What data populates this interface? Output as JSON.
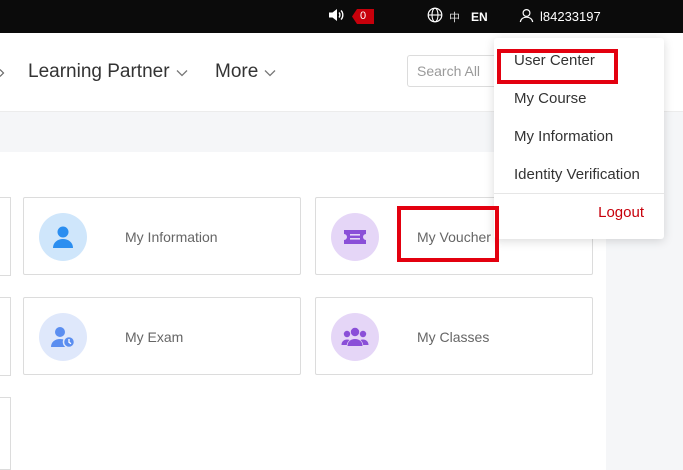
{
  "topbar": {
    "notification_count": "0",
    "lang_cn": "中",
    "lang_en": "EN",
    "username": "l84233197"
  },
  "nav": {
    "learning_partner": "Learning Partner",
    "more": "More"
  },
  "search": {
    "placeholder": "Search All"
  },
  "cards": {
    "my_information": "My Information",
    "my_voucher": "My Voucher",
    "my_exam": "My Exam",
    "my_classes": "My Classes"
  },
  "dropdown": {
    "user_center": "User Center",
    "my_course": "My Course",
    "my_information": "My Information",
    "identity_verification": "Identity Verification",
    "logout": "Logout"
  },
  "colors": {
    "brand_red": "#c7000b",
    "highlight_red": "#e3000f",
    "info_icon_bg": "#cfe6fb",
    "voucher_icon_bg": "#e5d6f7",
    "exam_icon_bg": "#dfe8fb",
    "classes_icon_bg": "#e5d6f7"
  },
  "icons": {
    "speaker": "speaker-icon",
    "globe": "globe-icon",
    "user": "user-icon",
    "person": "person-icon",
    "ticket": "ticket-icon",
    "exam": "exam-icon",
    "group": "group-icon"
  }
}
